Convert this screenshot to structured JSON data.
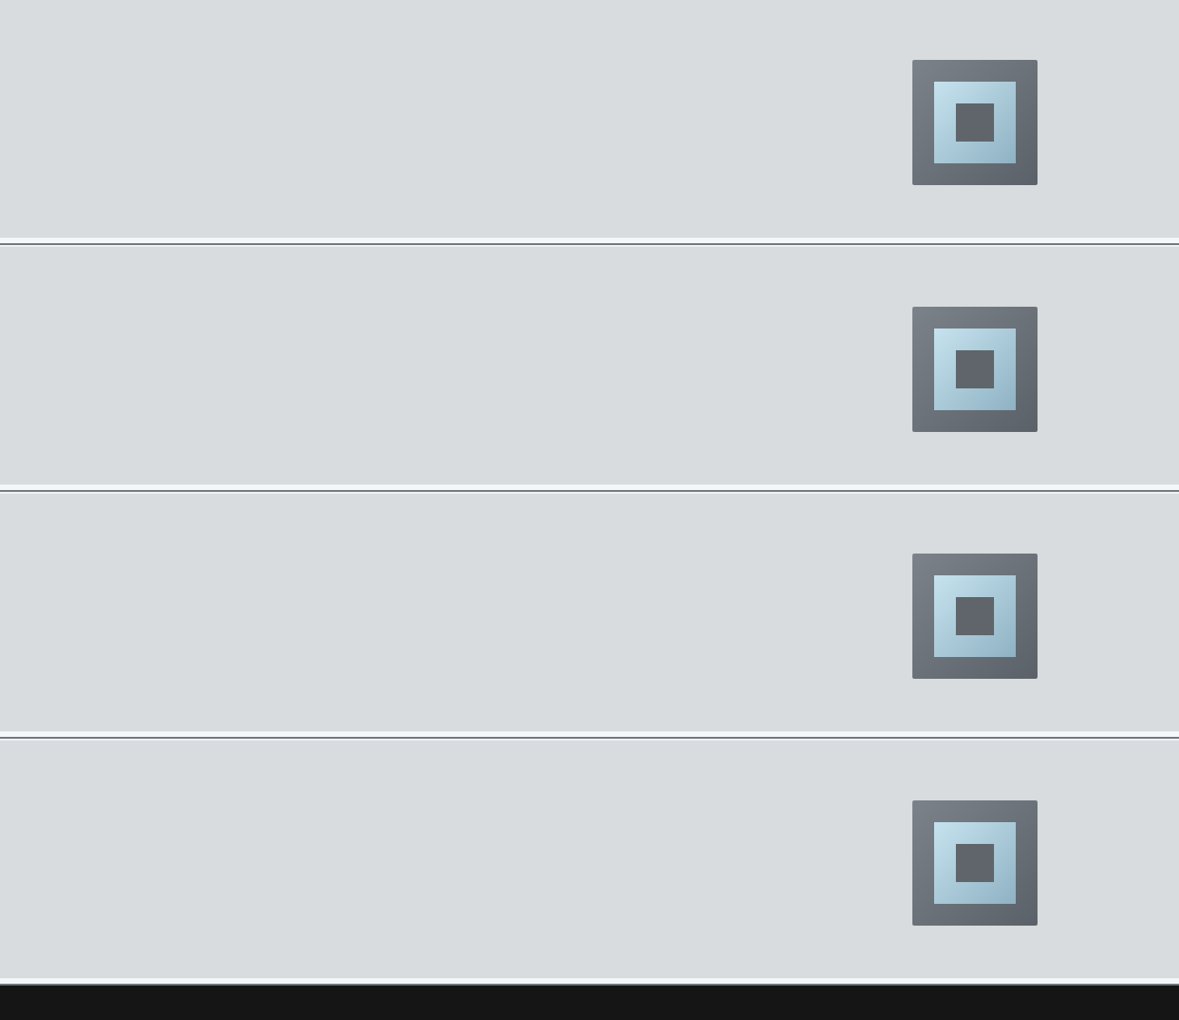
{
  "panels": [
    {
      "kind": "square-button"
    },
    {
      "kind": "square-button"
    },
    {
      "kind": "square-button"
    },
    {
      "kind": "square-button"
    }
  ]
}
